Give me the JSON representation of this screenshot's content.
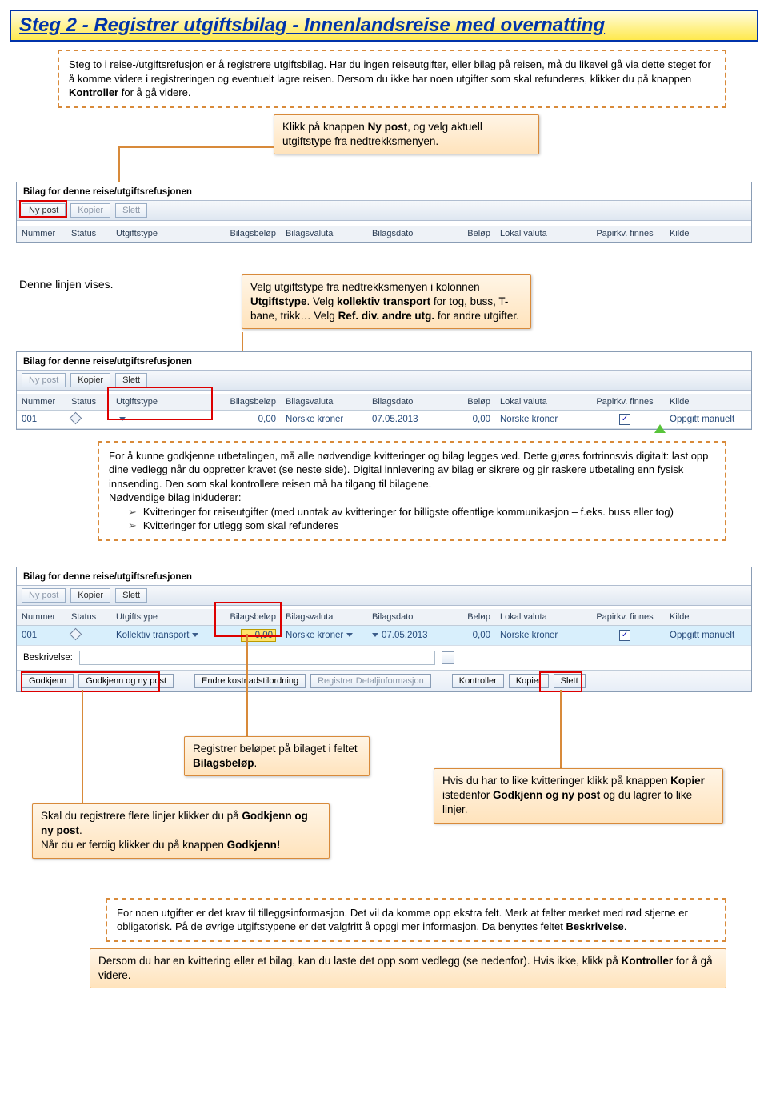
{
  "title": "Steg 2 - Registrer utgiftsbilag - Innenlandsreise med overnatting",
  "intro_html": "Steg to i reise-/utgiftsrefusjon er å registrere utgiftsbilag. Har du ingen reiseutgifter, eller bilag på reisen, må du likevel gå via dette steget for å komme videre i registreringen og eventuelt lagre reisen. Dersom du ikke har noen utgifter som skal refunderes, klikker du på knappen <b>Kontroller</b> for å gå videre.",
  "call_nypost_html": "Klikk på knappen <b>Ny post</b>, og velg aktuell utgiftstype fra nedtrekksmenyen.",
  "label_denne": "Denne linjen vises.",
  "call_utg_html": "Velg utgiftstype fra nedtrekksmenyen i kolonnen <b>Utgiftstype</b>. Velg <b>kollektiv transport</b> for tog, buss, T-bane, trikk… Velg <b>Ref. div. andre utg.</b> for andre utgifter.",
  "dashed_kvitt_html": "For å kunne godkjenne utbetalingen, må alle nødvendige kvitteringer og bilag legges ved. Dette gjøres fortrinnsvis digitalt: last opp dine vedlegg når du oppretter kravet (se neste side). Digital innlevering av bilag er sikrere og gir raskere utbetaling enn fysisk innsending. Den som skal kontrollere reisen må ha tilgang til bilagene.<br>Nødvendige bilag inkluderer:",
  "bul1": "Kvitteringer for reiseutgifter (med unntak av kvitteringer for billigste offentlige kommunikasjon – f.eks. buss eller tog)",
  "bul2": "Kvitteringer for utlegg som skal refunderes",
  "section_title": "Bilag for denne reise/utgiftsrefusjonen",
  "tabs": {
    "ny": "Ny post",
    "kopier": "Kopier",
    "slett": "Slett"
  },
  "cols": {
    "nummer": "Nummer",
    "status": "Status",
    "utg": "Utgiftstype",
    "bbel": "Bilagsbeløp",
    "bval": "Bilagsvaluta",
    "bdt": "Bilagsdato",
    "bel": "Beløp",
    "lval": "Lokal valuta",
    "pap": "Papirkv. finnes",
    "kld": "Kilde"
  },
  "row": {
    "nummer": "001",
    "bbel": "0,00",
    "bval": "Norske kroner",
    "bdt": "07.05.2013",
    "bel": "0,00",
    "lval": "Norske kroner",
    "kld": "Oppgitt manuelt",
    "utg_collective": "Kollektiv transport"
  },
  "beskr_label": "Beskrivelse:",
  "actbtns": {
    "godkjenn": "Godkjenn",
    "godny": "Godkjenn og ny post",
    "endre": "Endre kostnadstilordning",
    "regdet": "Registrer Detaljinformasjon",
    "kontroller": "Kontroller",
    "kopier": "Kopier",
    "slett": "Slett"
  },
  "call_belop_html": "Registrer beløpet på bilaget i feltet <b>Bilagsbeløp</b>.",
  "call_kopier_html": "Hvis du har to like kvitteringer klikk på knappen <b>Kopier</b> istedenfor <b>Godkjenn og ny post</b> og du lagrer to like linjer.",
  "call_godkjenn_html": "Skal du registrere flere linjer klikker du på <b>Godkjenn og ny post</b>.<br>Når du er ferdig klikker du på knappen <b>Godkjenn!</b>",
  "dashed_tillegg_html": "For noen utgifter er det krav til tilleggsinformasjon. Det vil da komme opp ekstra felt. Merk at felter merket med rød stjerne er obligatorisk. På de øvrige utgiftstypene er det valgfritt å oppgi mer informasjon. Da benyttes feltet <b>Beskrivelse</b>.",
  "dashed_vedlegg_html": "Dersom du har en kvittering eller et bilag, kan du laste det opp som vedlegg (se nedenfor). Hvis ikke, klikk på <b>Kontroller</b> for å gå videre."
}
